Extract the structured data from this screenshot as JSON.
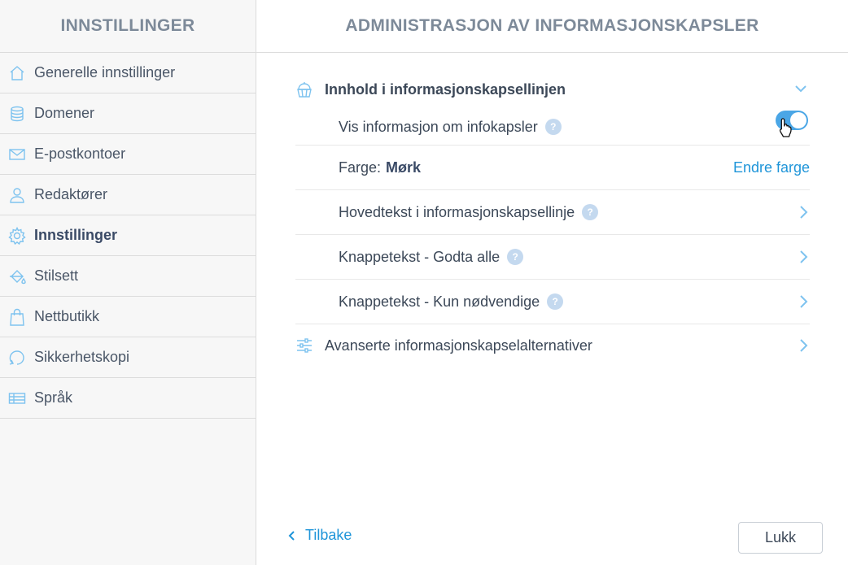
{
  "colors": {
    "accent": "#1f95d9",
    "toggle_on": "#4aa6e6",
    "help_badge": "#c4d9ef",
    "icon": "#7ec3ef"
  },
  "sidebar": {
    "title": "INNSTILLINGER",
    "items": [
      {
        "label": "Generelle innstillinger",
        "icon": "home-icon"
      },
      {
        "label": "Domener",
        "icon": "database-icon"
      },
      {
        "label": "E-postkontoer",
        "icon": "envelope-icon"
      },
      {
        "label": "Redaktører",
        "icon": "user-icon"
      },
      {
        "label": "Innstillinger",
        "icon": "gear-icon",
        "active": true
      },
      {
        "label": "Stilsett",
        "icon": "paint-bucket-icon"
      },
      {
        "label": "Nettbutikk",
        "icon": "shopping-bag-icon"
      },
      {
        "label": "Sikkerhetskopi",
        "icon": "backup-icon"
      },
      {
        "label": "Språk",
        "icon": "language-icon"
      }
    ]
  },
  "main": {
    "title": "ADMINISTRASJON AV INFORMASJONSKAPSLER",
    "section": {
      "title": "Innhold i informasjonskapsellinjen",
      "icon": "cupcake-icon",
      "rows": {
        "show_info": {
          "label": "Vis informasjon om infokapsler",
          "help": "?",
          "enabled": true
        },
        "color": {
          "label": "Farge:",
          "value": "Mørk",
          "link": "Endre farge"
        },
        "main_text": {
          "label": "Hovedtekst i informasjonskapsellinje",
          "help": "?"
        },
        "accept_all": {
          "label": "Knappetekst - Godta alle",
          "help": "?"
        },
        "necessary_only": {
          "label": "Knappetekst - Kun nødvendige",
          "help": "?"
        }
      }
    },
    "advanced": {
      "label": "Avanserte informasjonskapselalternativer",
      "icon": "sliders-icon"
    }
  },
  "footer": {
    "back_label": "Tilbake",
    "close_label": "Lukk"
  }
}
